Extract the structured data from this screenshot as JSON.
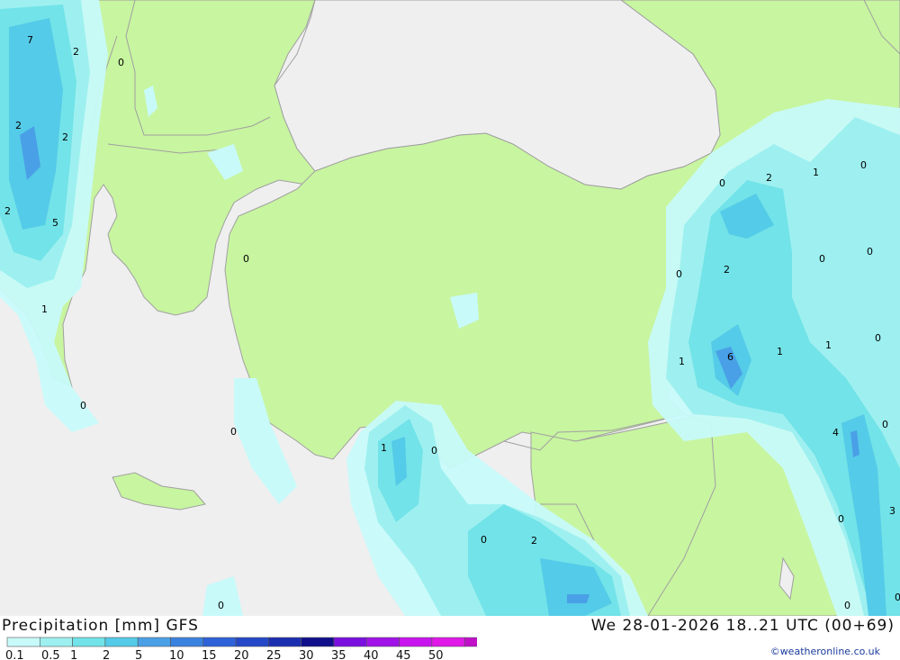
{
  "map": {
    "colors": {
      "sea": "#efefef",
      "land": "#c8f5a0",
      "border": "#a0a0a0",
      "precip": [
        "#c8fafa",
        "#9ef0f0",
        "#72e3e8",
        "#54cbe8",
        "#4aa0e6",
        "#3a6ee0"
      ]
    },
    "labels": [
      "7",
      "2",
      "0",
      "2",
      "2",
      "2",
      "5",
      "1",
      "0",
      "0",
      "0",
      "1",
      "0",
      "0",
      "0",
      "2",
      "0",
      "2",
      "1",
      "0",
      "0",
      "2",
      "0",
      "1",
      "6",
      "1",
      "1",
      "0",
      "4",
      "0",
      "0",
      "3",
      "0",
      "0",
      "0"
    ]
  },
  "footer": {
    "title": "Precipitation [mm] GFS",
    "run": "We 28-01-2026 18..21 UTC (00+69)",
    "copyright": "©weatheronline.co.uk"
  },
  "legend": {
    "ticks": [
      "0.1",
      "0.5",
      "1",
      "2",
      "5",
      "10",
      "15",
      "20",
      "25",
      "30",
      "35",
      "40",
      "45",
      "50"
    ],
    "colors": [
      "#c8fafa",
      "#9ef0f0",
      "#72e3e8",
      "#54cbe8",
      "#4aa0e6",
      "#3a82e0",
      "#2f62d8",
      "#2448c8",
      "#1c2eb0",
      "#10108c",
      "#7a10e0",
      "#a012e8",
      "#c814ee",
      "#e018e8",
      "#c010c8"
    ]
  }
}
